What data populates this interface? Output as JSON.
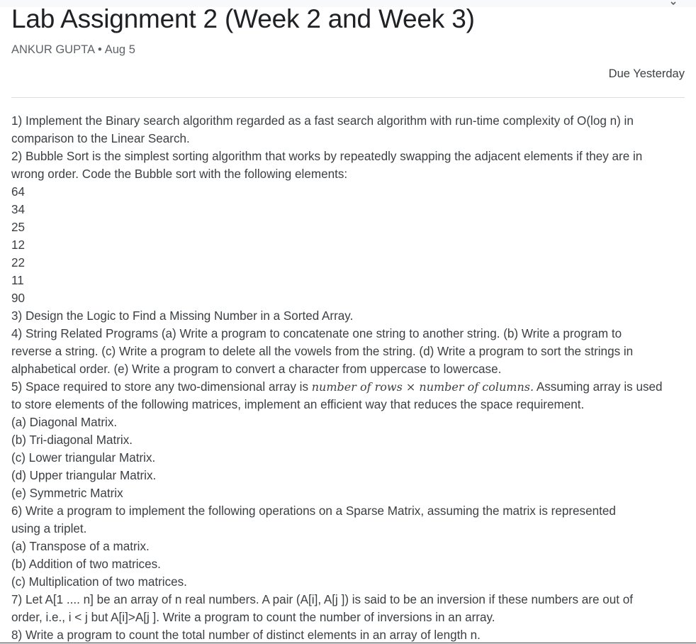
{
  "assignment": {
    "title": "Lab Assignment 2 (Week 2 and Week 3)",
    "author": "ANKUR GUPTA",
    "separator": "•",
    "date": "Aug 5",
    "due": "Due Yesterday"
  },
  "instructions": {
    "l01": "1) Implement the Binary search algorithm regarded as a fast search algorithm with run-time complexity of Ο(log n) in",
    "l02": "comparison to the Linear Search.",
    "l03": "2) Bubble Sort is the simplest sorting algorithm that works by repeatedly swapping the adjacent elements if they are in",
    "l04": "wrong order. Code the Bubble sort with the following elements:",
    "elements": [
      "64",
      "34",
      "25",
      "12",
      "22",
      "11",
      "90"
    ],
    "l12": "3) Design the Logic to Find a Missing Number in a Sorted Array.",
    "l13": "4) String Related Programs (a) Write a program to concatenate one string to another string. (b) Write a program to",
    "l14": "reverse a string. (c) Write a program to delete all the vowels from the string. (d) Write a program to sort the strings in",
    "l15": "alphabetical order. (e) Write a program to convert a character from uppercase to lowercase.",
    "l16a": "5) Space required to store any two-dimensional array is ",
    "l16math": "number of rows × number of columns.",
    "l16b": " Assuming array is used",
    "l17": "to store elements of the following matrices, implement an efficient way that reduces the space requirement.",
    "l18": "(a) Diagonal Matrix.",
    "l19": "(b) Tri-diagonal Matrix.",
    "l20": "(c) Lower triangular Matrix.",
    "l21": "(d) Upper triangular Matrix.",
    "l22": "(e) Symmetric Matrix",
    "l23": "6) Write a program to implement the following operations on a Sparse Matrix, assuming the matrix is represented",
    "l24": "using a triplet.",
    "l25": "(a) Transpose of a matrix.",
    "l26": "(b) Addition of two matrices.",
    "l27": "(c) Multiplication of two matrices.",
    "l28": "7) Let A[1 .... n] be an array of n real numbers. A pair (A[i], A[j ]) is said to be an inversion if these numbers are out of",
    "l29": "order, i.e., i < j but A[i]>A[j ]. Write a program to count the number of inversions in an array.",
    "l30": "8) Write a program to count the total number of distinct elements in an array of length n."
  }
}
